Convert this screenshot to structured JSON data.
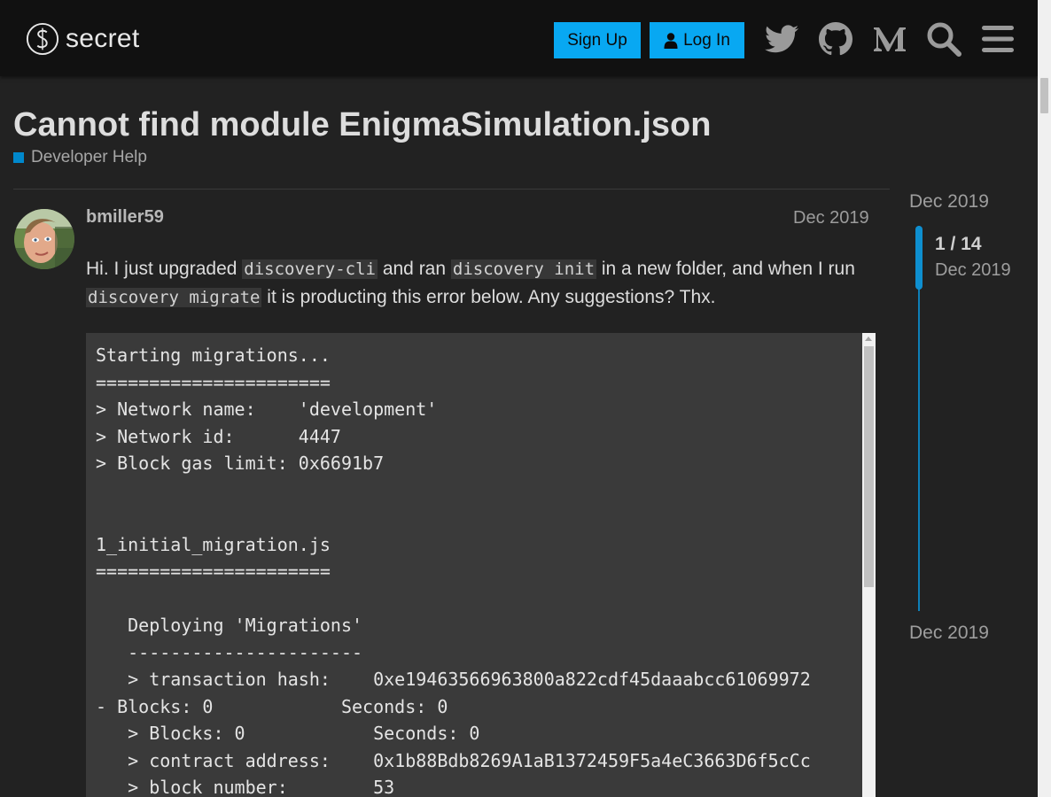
{
  "header": {
    "logo_text": "secret",
    "signup_label": "Sign Up",
    "login_label": "Log In",
    "icons": [
      "twitter-icon",
      "github-icon",
      "medium-icon",
      "search-icon",
      "hamburger-menu-icon"
    ],
    "accent_color": "#08a8f2"
  },
  "topic": {
    "title": "Cannot find module EnigmaSimulation.json",
    "category": "Developer Help",
    "category_color": "#0088cc"
  },
  "post": {
    "username": "bmiller59",
    "date": "Dec 2019",
    "text_parts": [
      "Hi. I just upgraded ",
      "discovery-cli",
      " and ran ",
      "discovery init",
      " in a new folder, and when I run ",
      "discovery migrate",
      " it is producting this error below. Any suggestions? Thx."
    ],
    "code_lines": [
      "Starting migrations...",
      "======================",
      "> Network name:    'development'",
      "> Network id:      4447",
      "> Block gas limit: 0x6691b7",
      "",
      "",
      "1_initial_migration.js",
      "======================",
      "",
      "   Deploying 'Migrations'",
      "   ----------------------",
      "   > transaction hash:    0xe19463566963800a822cdf45daaabcc61069972",
      "- Blocks: 0            Seconds: 0",
      "   > Blocks: 0            Seconds: 0",
      "   > contract address:    0x1b88Bdb8269A1aB1372459F5a4eC3663D6f5cCc",
      "   > block number:        53"
    ]
  },
  "timeline": {
    "start_date": "Dec 2019",
    "position": "1 / 14",
    "current_date": "Dec 2019",
    "end_date": "Dec 2019"
  }
}
